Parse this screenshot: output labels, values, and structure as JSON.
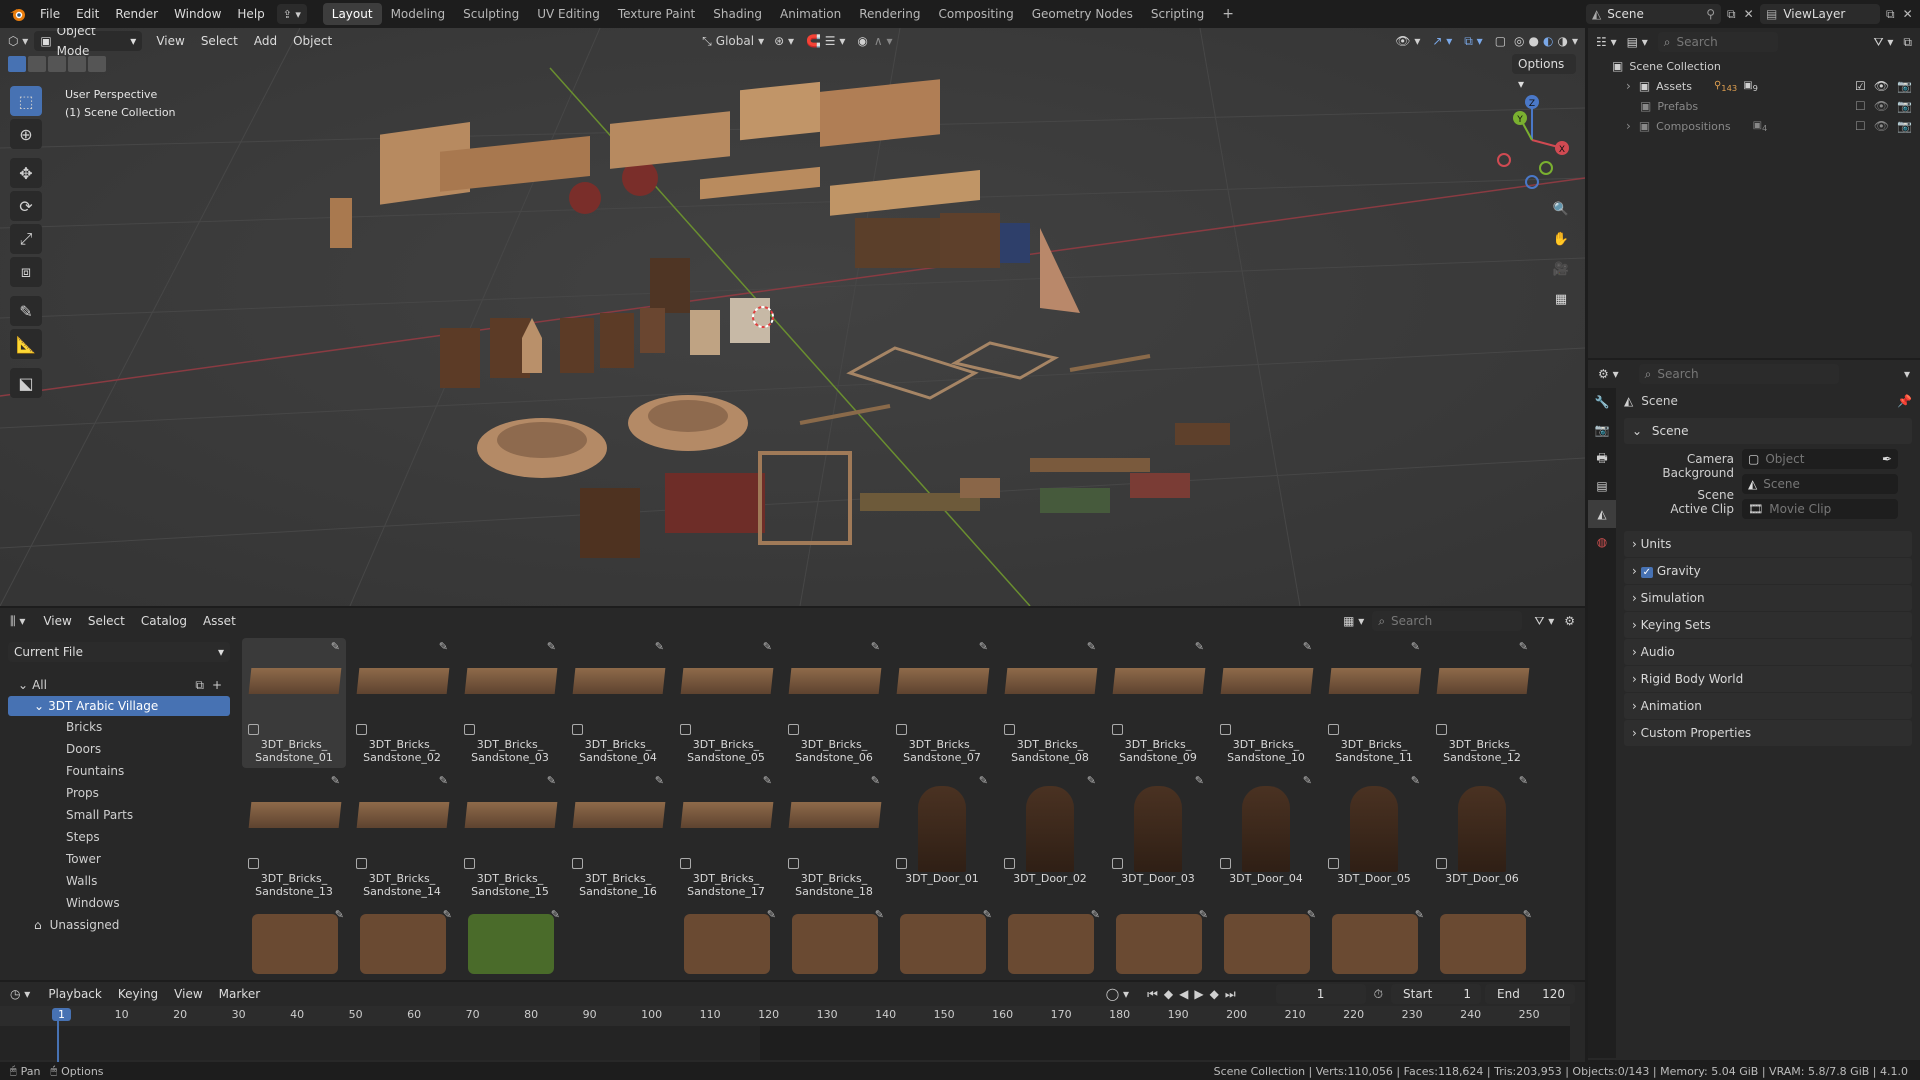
{
  "topbar": {
    "menus": [
      "File",
      "Edit",
      "Render",
      "Window",
      "Help"
    ],
    "workspaces": [
      "Layout",
      "Modeling",
      "Sculpting",
      "UV Editing",
      "Texture Paint",
      "Shading",
      "Animation",
      "Rendering",
      "Compositing",
      "Geometry Nodes",
      "Scripting"
    ],
    "active_workspace": "Layout",
    "scene_name": "Scene",
    "viewlayer_name": "ViewLayer"
  },
  "viewport": {
    "mode": "Object Mode",
    "menus": [
      "View",
      "Select",
      "Add",
      "Object"
    ],
    "transform_orientation": "Global",
    "options_label": "Options",
    "info_line1": "User Perspective",
    "info_line2": "(1) Scene Collection",
    "gizmo": {
      "x": "X",
      "y": "Y",
      "z": "Z"
    }
  },
  "outliner": {
    "search_placeholder": "Search",
    "root": "Scene Collection",
    "items": [
      {
        "label": "Assets",
        "badge1": "143",
        "badge2": "9"
      },
      {
        "label": "Prefabs",
        "badge1": "",
        "badge2": ""
      },
      {
        "label": "Compositions",
        "badge1": "4",
        "badge2": ""
      }
    ]
  },
  "properties": {
    "search_placeholder": "Search",
    "context_title": "Scene",
    "section_scene": "Scene",
    "camera_label": "Camera",
    "camera_value": "Object",
    "background_label": "Background Scene",
    "background_value": "Scene",
    "clip_label": "Active Clip",
    "clip_value": "Movie Clip",
    "panels": [
      "Units",
      "Gravity",
      "Simulation",
      "Keying Sets",
      "Audio",
      "Rigid Body World",
      "Animation",
      "Custom Properties"
    ]
  },
  "asset_browser": {
    "menus": [
      "View",
      "Select",
      "Catalog",
      "Asset"
    ],
    "library": "Current File",
    "search_placeholder": "Search",
    "catalog_all": "All",
    "catalog_root": "3DT Arabic Village",
    "catalogs": [
      "Bricks",
      "Doors",
      "Fountains",
      "Props",
      "Small Parts",
      "Steps",
      "Tower",
      "Walls",
      "Windows"
    ],
    "unassigned": "Unassigned",
    "row1": [
      "3DT_Bricks_\nSandstone_01",
      "3DT_Bricks_\nSandstone_02",
      "3DT_Bricks_\nSandstone_03",
      "3DT_Bricks_\nSandstone_04",
      "3DT_Bricks_\nSandstone_05",
      "3DT_Bricks_\nSandstone_06",
      "3DT_Bricks_\nSandstone_07",
      "3DT_Bricks_\nSandstone_08",
      "3DT_Bricks_\nSandstone_09",
      "3DT_Bricks_\nSandstone_10",
      "3DT_Bricks_\nSandstone_11",
      "3DT_Bricks_\nSandstone_12"
    ],
    "row2": [
      "3DT_Bricks_\nSandstone_13",
      "3DT_Bricks_\nSandstone_14",
      "3DT_Bricks_\nSandstone_15",
      "3DT_Bricks_\nSandstone_16",
      "3DT_Bricks_\nSandstone_17",
      "3DT_Bricks_\nSandstone_18",
      "3DT_Door_01",
      "3DT_Door_02",
      "3DT_Door_03",
      "3DT_Door_04",
      "3DT_Door_05",
      "3DT_Door_06"
    ]
  },
  "timeline": {
    "menus": [
      "Playback",
      "Keying",
      "View",
      "Marker"
    ],
    "current_frame": "1",
    "start_label": "Start",
    "start_value": "1",
    "end_label": "End",
    "end_value": "120",
    "ticks": [
      "1",
      "10",
      "20",
      "30",
      "40",
      "50",
      "60",
      "70",
      "80",
      "90",
      "100",
      "110",
      "120",
      "130",
      "140",
      "150",
      "160",
      "170",
      "180",
      "190",
      "200",
      "210",
      "220",
      "230",
      "240",
      "250"
    ]
  },
  "statusbar": {
    "left1": "Pan",
    "left2": "Options",
    "stats": "Scene Collection | Verts:110,056 | Faces:118,624 | Tris:203,953 | Objects:0/143 | Memory: 5.04 GiB | VRAM: 5.8/7.8 GiB | 4.1.0"
  }
}
